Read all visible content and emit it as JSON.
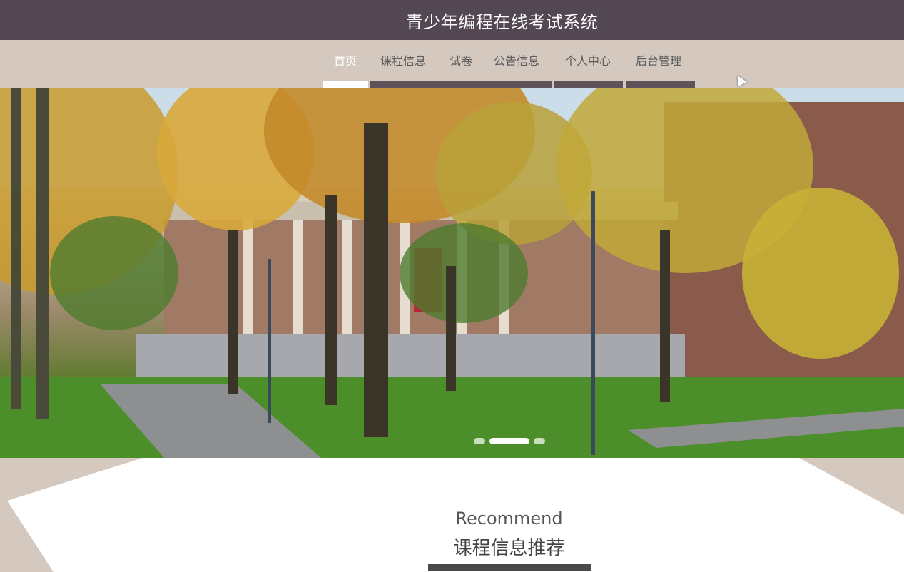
{
  "header": {
    "title": "青少年编程在线考试系统",
    "background": "#524752"
  },
  "nav": {
    "items": [
      {
        "label": "首页",
        "active": true
      },
      {
        "label": "课程信息",
        "active": false
      },
      {
        "label": "试卷",
        "active": false
      },
      {
        "label": "公告信息",
        "active": false
      },
      {
        "label": "个人中心",
        "active": false
      },
      {
        "label": "后台管理",
        "active": false
      }
    ],
    "background": "#d4c8bf",
    "active_color": "#ffffff",
    "inactive_color": "#5a5a5a"
  },
  "banner": {
    "image_subject": "autumn-campus-trees-building",
    "carousel_slides": 3,
    "active_slide": 2
  },
  "recommend": {
    "title_en": "Recommend",
    "title_zh": "课程信息推荐"
  }
}
